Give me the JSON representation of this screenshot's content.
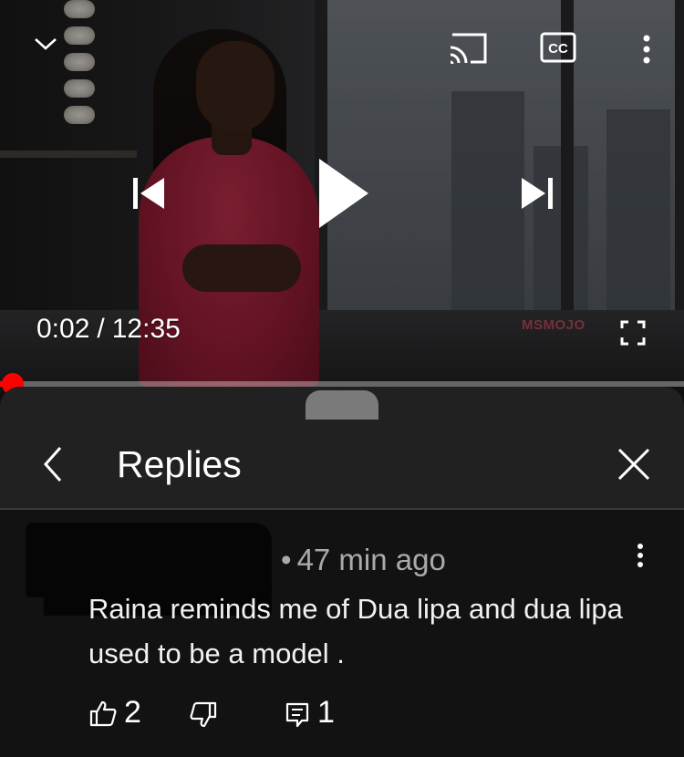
{
  "player": {
    "current_time": "0:02",
    "separator": "/",
    "duration": "12:35",
    "watermark": "MSMOJO",
    "progress_fraction": 0.003,
    "icons": {
      "minimize": "chevron-down-icon",
      "cast": "cast-icon",
      "captions": "captions-cc-icon",
      "more": "more-vert-icon",
      "previous": "skip-previous-icon",
      "play": "play-icon",
      "next": "skip-next-icon",
      "fullscreen": "fullscreen-icon"
    },
    "accent_color": "#ff0000"
  },
  "replies_panel": {
    "title": "Replies",
    "back_icon": "chevron-left-icon",
    "close_icon": "close-icon"
  },
  "comment": {
    "timestamp": "47 min ago",
    "separator": "•",
    "text": "Raina reminds me of Dua lipa and dua lipa used to be a model .",
    "likes": "2",
    "replies": "1",
    "icons": {
      "like": "thumbs-up-icon",
      "dislike": "thumbs-down-icon",
      "reply": "reply-comment-icon",
      "menu": "more-vert-icon"
    }
  }
}
